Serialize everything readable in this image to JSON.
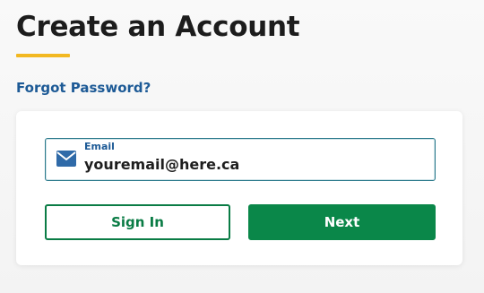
{
  "page": {
    "title": "Create an Account"
  },
  "links": {
    "forgot_password": "Forgot Password?"
  },
  "email_field": {
    "label": "Email",
    "value": "youremail@here.ca",
    "icon": "envelope-icon"
  },
  "buttons": {
    "sign_in": "Sign In",
    "next": "Next"
  },
  "colors": {
    "accent_underline": "#f2b821",
    "link_blue": "#1d5a96",
    "primary_green": "#0a8749",
    "envelope_blue": "#2f6aa8"
  }
}
